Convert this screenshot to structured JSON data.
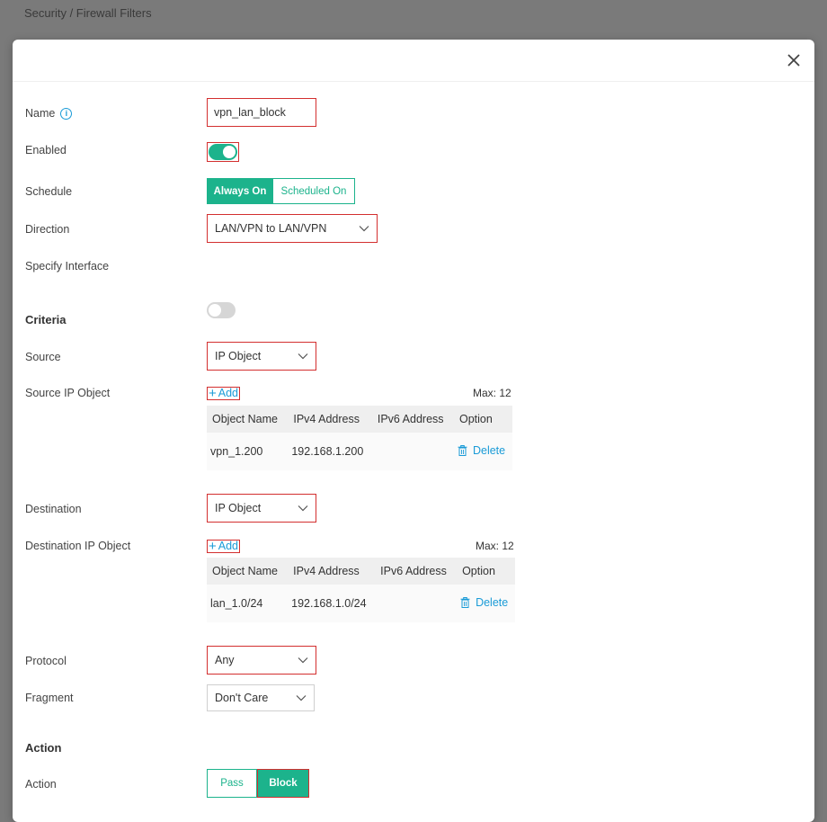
{
  "breadcrumb": "Security / Firewall Filters",
  "labels": {
    "name": "Name",
    "enabled": "Enabled",
    "schedule": "Schedule",
    "direction": "Direction",
    "specify_interface": "Specify Interface",
    "source": "Source",
    "source_ip_object": "Source IP Object",
    "destination": "Destination",
    "destination_ip_object": "Destination IP Object",
    "protocol": "Protocol",
    "fragment": "Fragment",
    "action": "Action"
  },
  "sections": {
    "criteria": "Criteria",
    "action": "Action"
  },
  "name_value": "vpn_lan_block",
  "info_glyph": "i",
  "schedule_options": [
    "Always On",
    "Scheduled On"
  ],
  "direction_value": "LAN/VPN to LAN/VPN",
  "source_value": "IP Object",
  "destination_value": "IP Object",
  "protocol_value": "Any",
  "fragment_value": "Don't Care",
  "add_label": "Add",
  "add_glyph": "+",
  "max_label": "Max: 12",
  "table_headers": [
    "Object Name",
    "IPv4 Address",
    "IPv6 Address",
    "Option"
  ],
  "source_objects": [
    {
      "name": "vpn_1.200",
      "ipv4": "192.168.1.200",
      "ipv6": "",
      "option": "Delete"
    }
  ],
  "destination_objects": [
    {
      "name": "lan_1.0/24",
      "ipv4": "192.168.1.0/24",
      "ipv6": "",
      "option": "Delete"
    }
  ],
  "action_options": [
    "Pass",
    "Block"
  ],
  "colors": {
    "accent": "#1cb38c",
    "link": "#1a9bd7",
    "highlight": "#d32f2f"
  }
}
